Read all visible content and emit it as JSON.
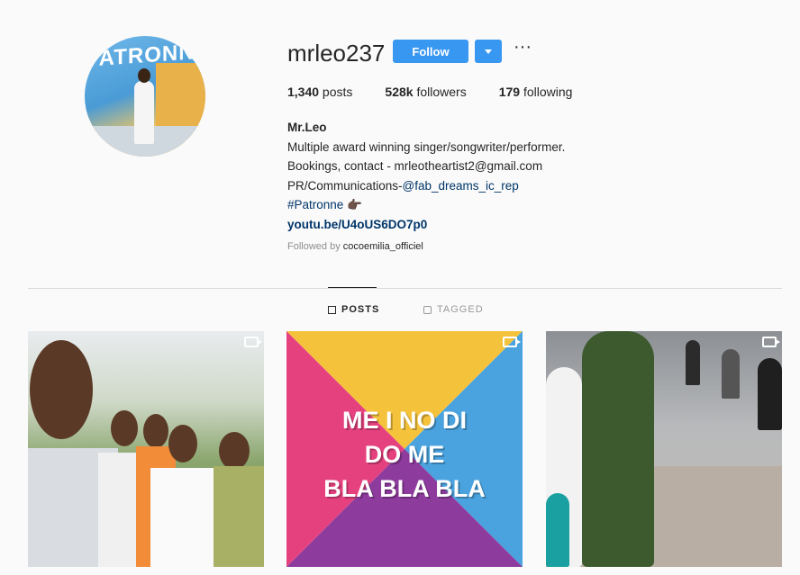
{
  "profile": {
    "username": "mrleo237",
    "follow_label": "Follow",
    "more_label": "···",
    "avatar_text": "PATRONNE",
    "stats": {
      "posts_count": "1,340",
      "posts_label": " posts",
      "followers_count": "528k",
      "followers_label": " followers",
      "following_count": "179",
      "following_label": " following"
    },
    "bio": {
      "name": "Mr.Leo",
      "line1": "Multiple award winning singer/songwriter/performer.",
      "line2": "Bookings, contact - mrleotheartist2@gmail.com",
      "line3_prefix": "PR/Communications-",
      "line3_mention": "@fab_dreams_ic_rep",
      "line4_hashtag": "#Patronne",
      "line4_emoji": "👉🏿",
      "link": "youtu.be/U4oUS6DO7p0"
    },
    "followed_by_label": "Followed by ",
    "followed_by_user": "cocoemilia_officiel"
  },
  "tabs": [
    {
      "label": "POSTS",
      "active": true
    },
    {
      "label": "TAGGED",
      "active": false
    }
  ],
  "posts": [
    {
      "type": "video"
    },
    {
      "type": "video",
      "overlay_lines": [
        "ME I NO DI",
        "DO ME",
        "BLA BLA BLA"
      ]
    },
    {
      "type": "video"
    }
  ],
  "colors": {
    "accent": "#3897f0",
    "link": "#003569",
    "muted": "#8e8e8e"
  }
}
